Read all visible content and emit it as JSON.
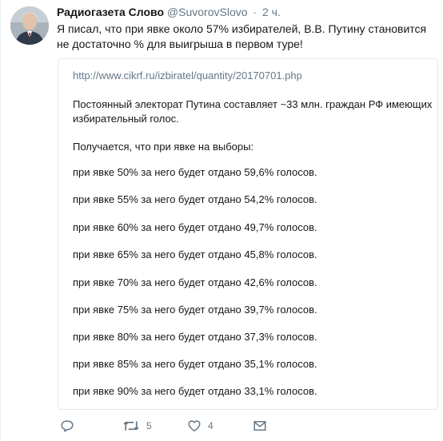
{
  "tweet": {
    "author_name": "Радиогазета Слово",
    "handle": "@SuvorovSlovo",
    "separator": "·",
    "time": "2 ч.",
    "text_line1": "Я писал, что при явке около 57% избирателей,  В.В. Путину становится",
    "text_line2": "не достаточно % для выигрыша в первом туре!"
  },
  "quote": {
    "url": "http://www.cikrf.ru/izbiratel/quantity/20170701.php",
    "paragraph": "Постоянный электорат Путина составляет ~33 млн. граждан РФ имеющих избирательный голос.",
    "intro": "Получается, что при явке на выборы:",
    "lines": [
      "при явке 50% за него будет отдано 59,6% голосов.",
      "при явке 55% за него будет отдано 54,2% голосов.",
      "при явке 60% за него будет отдано 49,7% голосов.",
      "при явке 65% за него будет отдано 45,8% голосов.",
      "при явке 70% за него будет отдано 42,6% голосов.",
      "при явке 75% за него будет отдано 39,7% голосов.",
      "при явке 80% за него будет отдано 37,3% голосов.",
      "при явке 85% за него будет отдано 35,1% голосов.",
      "при явке 90% за него будет отдано 33,1% голосов."
    ]
  },
  "actions": {
    "reply_icon": "reply-icon",
    "retweet_icon": "retweet-icon",
    "retweet_count": "5",
    "like_icon": "heart-icon",
    "like_count": "4",
    "dm_icon": "envelope-icon"
  },
  "colors": {
    "text": "#14171a",
    "muted": "#657786",
    "border": "#e1e8ed"
  }
}
